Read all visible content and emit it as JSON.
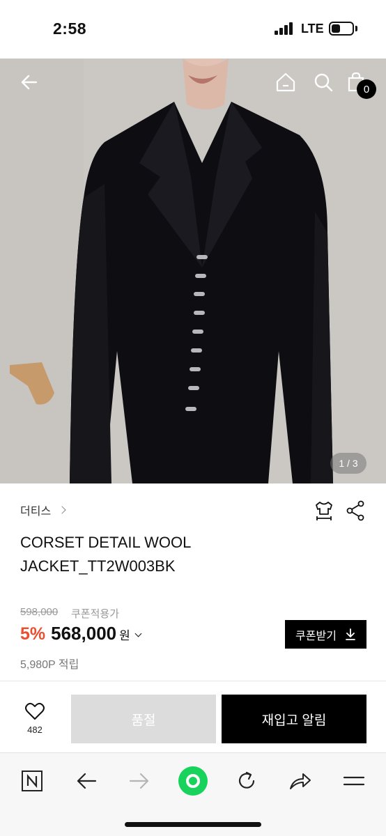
{
  "status_bar": {
    "time": "2:58",
    "network": "LTE"
  },
  "hero": {
    "pager": "1 / 3",
    "cart_count": "0",
    "icons": [
      "back-arrow-icon",
      "home-icon",
      "search-icon",
      "shopping-bag-icon"
    ]
  },
  "product": {
    "brand": "더티스",
    "title": "CORSET DETAIL WOOL JACKET_TT2W003BK",
    "original_price": "598,000",
    "coupon_price_label": "쿠폰적용가",
    "discount": "5%",
    "price": "568,000",
    "currency": "원",
    "coupon_button": "쿠폰받기",
    "points": "5,980P 적립",
    "tool_icons": [
      "size-guide-icon",
      "share-icon"
    ]
  },
  "actions": {
    "like_count": "482",
    "soldout_label": "품절",
    "restock_label": "재입고 알림"
  },
  "browser_toolbar": {
    "icons": [
      "naver-n-icon",
      "back-icon",
      "forward-icon",
      "green-home-icon",
      "refresh-icon",
      "share-icon",
      "menu-icon"
    ]
  },
  "colors": {
    "discount": "#e8502f",
    "primary_button": "#000000",
    "disabled_button": "#dcdcdc",
    "green_accent": "#17d35b"
  }
}
